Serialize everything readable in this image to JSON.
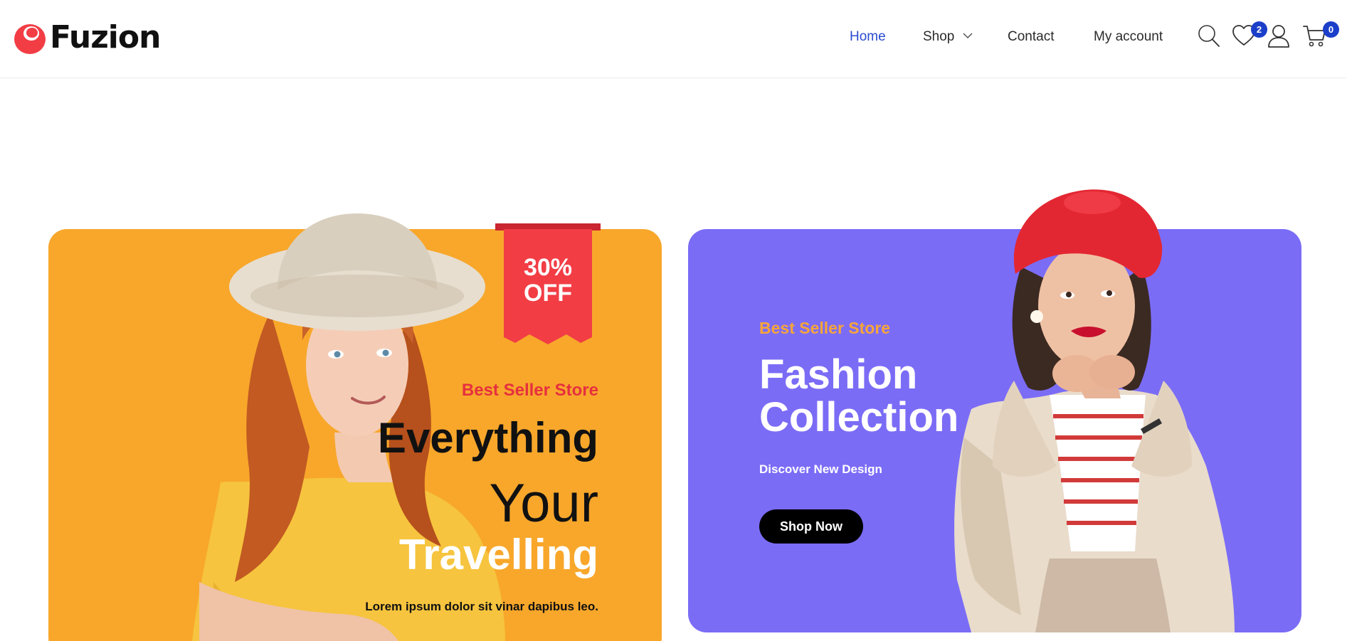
{
  "brand": {
    "name": "Fuzion",
    "accent": "#f23d45"
  },
  "nav": {
    "items": [
      {
        "label": "Home",
        "active": true
      },
      {
        "label": "Shop",
        "active": false,
        "has_dropdown": true
      },
      {
        "label": "Contact",
        "active": false
      },
      {
        "label": "My account",
        "active": false
      }
    ]
  },
  "header_icons": {
    "search": "search-icon",
    "wishlist": {
      "icon": "heart-icon",
      "count": "2"
    },
    "account": "user-icon",
    "cart": {
      "icon": "cart-icon",
      "count": "0"
    }
  },
  "banner_left": {
    "bg_color": "#f8a72b",
    "ribbon": {
      "line1": "30%",
      "line2": "OFF",
      "color": "#f23d45"
    },
    "kicker": "Best Seller Store",
    "line1": "Everything",
    "line2": "Your",
    "line3": "Travelling",
    "subtitle": "Lorem ipsum dolor sit vinar dapibus leo."
  },
  "banner_right": {
    "bg_color": "#7b6cf6",
    "kicker": "Best Seller Store",
    "title": "Fashion Collection",
    "subtitle": "Discover New Design",
    "button": "Shop Now"
  }
}
